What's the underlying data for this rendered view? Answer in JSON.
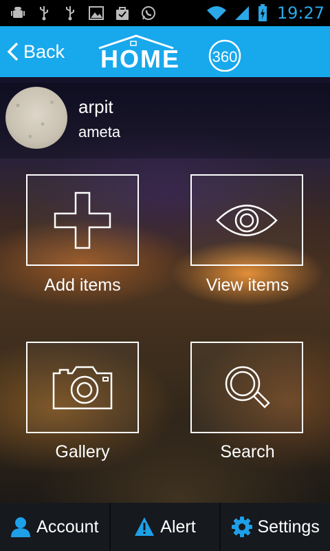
{
  "status_bar": {
    "time": "19:27",
    "icons": [
      "android-debug-icon",
      "usb-icon",
      "usb-icon",
      "image-icon",
      "shopping-bag-icon",
      "whatsapp-icon",
      "wifi-icon",
      "signal-icon",
      "battery-charging-icon"
    ],
    "accent_color": "#2aa8e8"
  },
  "app_bar": {
    "back_label": "Back",
    "logo_text": "HOME",
    "logo_number": "360",
    "color": "#18a8ec"
  },
  "profile": {
    "first_name": "arpit",
    "last_name": "ameta"
  },
  "tiles": [
    {
      "label": "Add items",
      "icon": "plus-icon"
    },
    {
      "label": "View items",
      "icon": "eye-icon"
    },
    {
      "label": "Gallery",
      "icon": "camera-icon"
    },
    {
      "label": "Search",
      "icon": "search-icon"
    }
  ],
  "bottom_bar": {
    "tabs": [
      {
        "label": "Account",
        "icon": "user-icon",
        "icon_color": "#1ea0e8"
      },
      {
        "label": "Alert",
        "icon": "warning-icon",
        "icon_color": "#1ea0e8"
      },
      {
        "label": "Settings",
        "icon": "gear-icon",
        "icon_color": "#1ea0e8"
      }
    ]
  }
}
